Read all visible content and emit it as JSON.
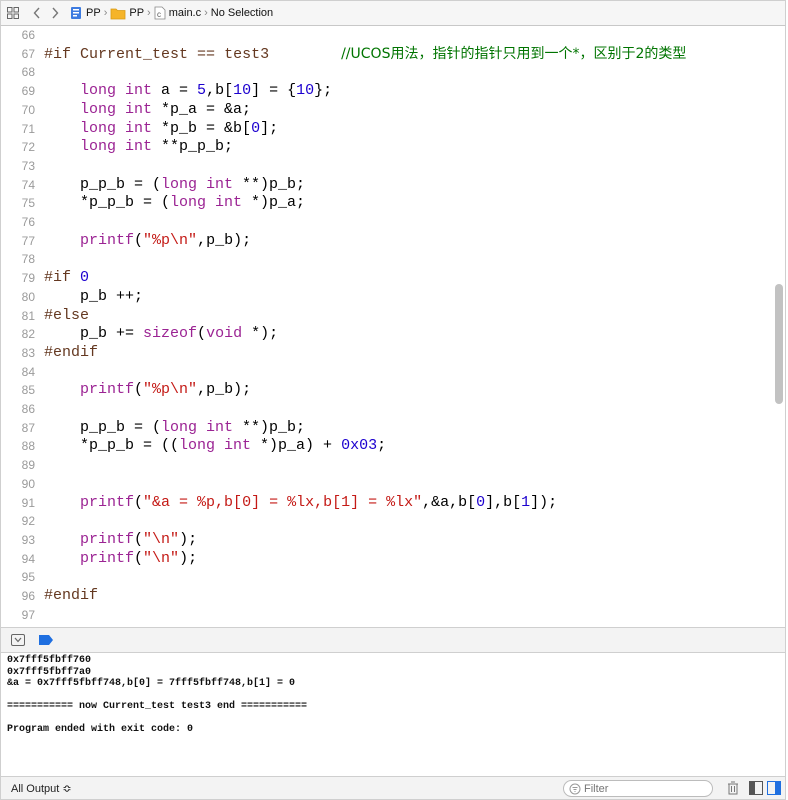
{
  "jumpbar": {
    "breadcrumb": [
      "PP",
      "PP",
      "main.c",
      "No Selection"
    ]
  },
  "editor": {
    "lines": [
      {
        "n": "66",
        "tokens": []
      },
      {
        "n": "67",
        "tokens": [
          {
            "t": "#if ",
            "c": "pp"
          },
          {
            "t": "Current_test",
            "c": "pp"
          },
          {
            "t": " == ",
            "c": "pp"
          },
          {
            "t": "test3",
            "c": "pp"
          },
          {
            "t": "        ",
            "c": ""
          },
          {
            "t": "//UCOS用法，指针的指针只用到一个*，区别于2的类型",
            "c": "cmt"
          }
        ]
      },
      {
        "n": "68",
        "tokens": []
      },
      {
        "n": "69",
        "tokens": [
          {
            "t": "    ",
            "c": ""
          },
          {
            "t": "long int",
            "c": "kw"
          },
          {
            "t": " a = ",
            "c": ""
          },
          {
            "t": "5",
            "c": "num"
          },
          {
            "t": ",b[",
            "c": ""
          },
          {
            "t": "10",
            "c": "num"
          },
          {
            "t": "] = {",
            "c": ""
          },
          {
            "t": "10",
            "c": "num"
          },
          {
            "t": "};",
            "c": ""
          }
        ]
      },
      {
        "n": "70",
        "tokens": [
          {
            "t": "    ",
            "c": ""
          },
          {
            "t": "long int",
            "c": "kw"
          },
          {
            "t": " *p_a = &a;",
            "c": ""
          }
        ]
      },
      {
        "n": "71",
        "tokens": [
          {
            "t": "    ",
            "c": ""
          },
          {
            "t": "long int",
            "c": "kw"
          },
          {
            "t": " *p_b = &b[",
            "c": ""
          },
          {
            "t": "0",
            "c": "num"
          },
          {
            "t": "];",
            "c": ""
          }
        ]
      },
      {
        "n": "72",
        "tokens": [
          {
            "t": "    ",
            "c": ""
          },
          {
            "t": "long int",
            "c": "kw"
          },
          {
            "t": " **p_p_b;",
            "c": ""
          }
        ]
      },
      {
        "n": "73",
        "tokens": []
      },
      {
        "n": "74",
        "tokens": [
          {
            "t": "    p_p_b = (",
            "c": ""
          },
          {
            "t": "long int",
            "c": "kw"
          },
          {
            "t": " **)p_b;",
            "c": ""
          }
        ]
      },
      {
        "n": "75",
        "tokens": [
          {
            "t": "    *p_p_b = (",
            "c": ""
          },
          {
            "t": "long int",
            "c": "kw"
          },
          {
            "t": " *)p_a;",
            "c": ""
          }
        ]
      },
      {
        "n": "76",
        "tokens": []
      },
      {
        "n": "77",
        "tokens": [
          {
            "t": "    ",
            "c": ""
          },
          {
            "t": "printf",
            "c": "kw"
          },
          {
            "t": "(",
            "c": ""
          },
          {
            "t": "\"%p\\n\"",
            "c": "str"
          },
          {
            "t": ",p_b);",
            "c": ""
          }
        ]
      },
      {
        "n": "78",
        "tokens": []
      },
      {
        "n": "79",
        "tokens": [
          {
            "t": "#if ",
            "c": "pp"
          },
          {
            "t": "0",
            "c": "num"
          }
        ]
      },
      {
        "n": "80",
        "tokens": [
          {
            "t": "    p_b ++;",
            "c": ""
          }
        ]
      },
      {
        "n": "81",
        "tokens": [
          {
            "t": "#else",
            "c": "pp"
          }
        ]
      },
      {
        "n": "82",
        "tokens": [
          {
            "t": "    p_b += ",
            "c": ""
          },
          {
            "t": "sizeof",
            "c": "kw"
          },
          {
            "t": "(",
            "c": ""
          },
          {
            "t": "void",
            "c": "kw"
          },
          {
            "t": " *);",
            "c": ""
          }
        ]
      },
      {
        "n": "83",
        "tokens": [
          {
            "t": "#endif",
            "c": "pp"
          }
        ]
      },
      {
        "n": "84",
        "tokens": []
      },
      {
        "n": "85",
        "tokens": [
          {
            "t": "    ",
            "c": ""
          },
          {
            "t": "printf",
            "c": "kw"
          },
          {
            "t": "(",
            "c": ""
          },
          {
            "t": "\"%p\\n\"",
            "c": "str"
          },
          {
            "t": ",p_b);",
            "c": ""
          }
        ]
      },
      {
        "n": "86",
        "tokens": []
      },
      {
        "n": "87",
        "tokens": [
          {
            "t": "    p_p_b = (",
            "c": ""
          },
          {
            "t": "long int",
            "c": "kw"
          },
          {
            "t": " **)p_b;",
            "c": ""
          }
        ]
      },
      {
        "n": "88",
        "tokens": [
          {
            "t": "    *p_p_b = ((",
            "c": ""
          },
          {
            "t": "long int",
            "c": "kw"
          },
          {
            "t": " *)p_a) + ",
            "c": ""
          },
          {
            "t": "0x03",
            "c": "num"
          },
          {
            "t": ";",
            "c": ""
          }
        ]
      },
      {
        "n": "89",
        "tokens": []
      },
      {
        "n": "90",
        "tokens": []
      },
      {
        "n": "91",
        "tokens": [
          {
            "t": "    ",
            "c": ""
          },
          {
            "t": "printf",
            "c": "kw"
          },
          {
            "t": "(",
            "c": ""
          },
          {
            "t": "\"&a = %p,b[0] = %lx,b[1] = %lx\"",
            "c": "str"
          },
          {
            "t": ",&a,b[",
            "c": ""
          },
          {
            "t": "0",
            "c": "num"
          },
          {
            "t": "],b[",
            "c": ""
          },
          {
            "t": "1",
            "c": "num"
          },
          {
            "t": "]);",
            "c": ""
          }
        ]
      },
      {
        "n": "92",
        "tokens": []
      },
      {
        "n": "93",
        "tokens": [
          {
            "t": "    ",
            "c": ""
          },
          {
            "t": "printf",
            "c": "kw"
          },
          {
            "t": "(",
            "c": ""
          },
          {
            "t": "\"\\n\"",
            "c": "str"
          },
          {
            "t": ");",
            "c": ""
          }
        ]
      },
      {
        "n": "94",
        "tokens": [
          {
            "t": "    ",
            "c": ""
          },
          {
            "t": "printf",
            "c": "kw"
          },
          {
            "t": "(",
            "c": ""
          },
          {
            "t": "\"\\n\"",
            "c": "str"
          },
          {
            "t": ");",
            "c": ""
          }
        ]
      },
      {
        "n": "95",
        "tokens": []
      },
      {
        "n": "96",
        "tokens": [
          {
            "t": "#endif",
            "c": "pp"
          }
        ]
      },
      {
        "n": "97",
        "tokens": []
      }
    ]
  },
  "console": {
    "lines": [
      "0x7fff5fbff760",
      "0x7fff5fbff7a0",
      "&a = 0x7fff5fbff748,b[0] = 7fff5fbff748,b[1] = 0",
      "",
      "=========== now Current_test test3 end ===========",
      "",
      "Program ended with exit code: 0"
    ]
  },
  "bottombar": {
    "output_selector": "All Output ≎",
    "filter_placeholder": "Filter"
  },
  "colors": {
    "keyword": "#9b2393",
    "preprocessor": "#643820",
    "string": "#c41a16",
    "number": "#1c00cf",
    "comment": "#007400",
    "breakpoint_blue": "#1f6fe0"
  },
  "icons": {
    "grid": "related-items-grid-icon",
    "back": "chevron-left-icon",
    "forward": "chevron-right-icon",
    "project": "xcode-project-icon",
    "folder": "folder-icon",
    "cfile": "c-file-icon",
    "hide_debug": "hide-debug-area-icon",
    "breakpoints": "breakpoints-icon",
    "filter": "filter-icon",
    "trash": "trash-icon"
  }
}
